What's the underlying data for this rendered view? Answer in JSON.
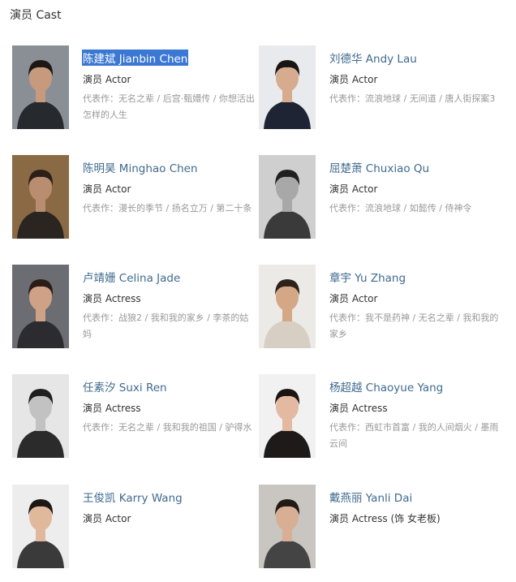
{
  "section": {
    "title": "演员 Cast"
  },
  "works_prefix": "代表作：",
  "separator": " / ",
  "cast": [
    {
      "name": "陈建斌 Jianbin Chen",
      "role": "演员 Actor",
      "works": [
        "无名之辈",
        "后宫·甄嬛传",
        "你想活出怎样的人生"
      ],
      "selected": true,
      "skin": "#c79a7e",
      "hair": "#1c1714",
      "bg": "#8a8f96",
      "cloth": "#262a2f"
    },
    {
      "name": "刘德华 Andy Lau",
      "role": "演员 Actor",
      "works": [
        "流浪地球",
        "无间道",
        "唐人街探案3"
      ],
      "selected": false,
      "skin": "#d6ab8e",
      "hair": "#181514",
      "bg": "#e9eaee",
      "cloth": "#1e2433"
    },
    {
      "name": "陈明昊 Minghao Chen",
      "role": "演员 Actor",
      "works": [
        "漫长的季节",
        "扬名立万",
        "第二十条"
      ],
      "selected": false,
      "skin": "#b88d70",
      "hair": "#2b1f17",
      "bg": "#8a6a44",
      "cloth": "#2a2520"
    },
    {
      "name": "屈楚萧 Chuxiao Qu",
      "role": "演员 Actor",
      "works": [
        "流浪地球",
        "如懿传",
        "侍神令"
      ],
      "selected": false,
      "skin": "#a8a8a8",
      "hair": "#202020",
      "bg": "#cfcfcf",
      "cloth": "#3a3a3a"
    },
    {
      "name": "卢靖姗 Celina Jade",
      "role": "演员 Actress",
      "works": [
        "战狼2",
        "我和我的家乡",
        "李茶的姑妈"
      ],
      "selected": false,
      "skin": "#cfa187",
      "hair": "#2a1d16",
      "bg": "#6b6d72",
      "cloth": "#2c2c30"
    },
    {
      "name": "章宇 Yu Zhang",
      "role": "演员 Actor",
      "works": [
        "我不是药神",
        "无名之辈",
        "我和我的家乡"
      ],
      "selected": false,
      "skin": "#d4a886",
      "hair": "#2e221a",
      "bg": "#eceae6",
      "cloth": "#d7cfc3"
    },
    {
      "name": "任素汐 Suxi Ren",
      "role": "演员 Actress",
      "works": [
        "无名之辈",
        "我和我的祖国",
        "驴得水"
      ],
      "selected": false,
      "skin": "#c2c2c2",
      "hair": "#1f1f1f",
      "bg": "#e6e6e6",
      "cloth": "#2b2b2b"
    },
    {
      "name": "杨超越 Chaoyue Yang",
      "role": "演员 Actress",
      "works": [
        "西虹市首富",
        "我的人间烟火",
        "墨雨云间"
      ],
      "selected": false,
      "skin": "#e3b9a2",
      "hair": "#1b1512",
      "bg": "#f1f1f1",
      "cloth": "#1e1a1a"
    },
    {
      "name": "王俊凯 Karry Wang",
      "role": "演员 Actor",
      "works": [],
      "selected": false,
      "skin": "#e0b99c",
      "hair": "#1d1714",
      "bg": "#ededed",
      "cloth": "#3a3a3a"
    },
    {
      "name": "戴燕丽 Yanli Dai",
      "role": "演员 Actress (饰 女老板)",
      "works": [],
      "selected": false,
      "skin": "#d8ae94",
      "hair": "#221a15",
      "bg": "#c9c6c1",
      "cloth": "#444"
    }
  ]
}
